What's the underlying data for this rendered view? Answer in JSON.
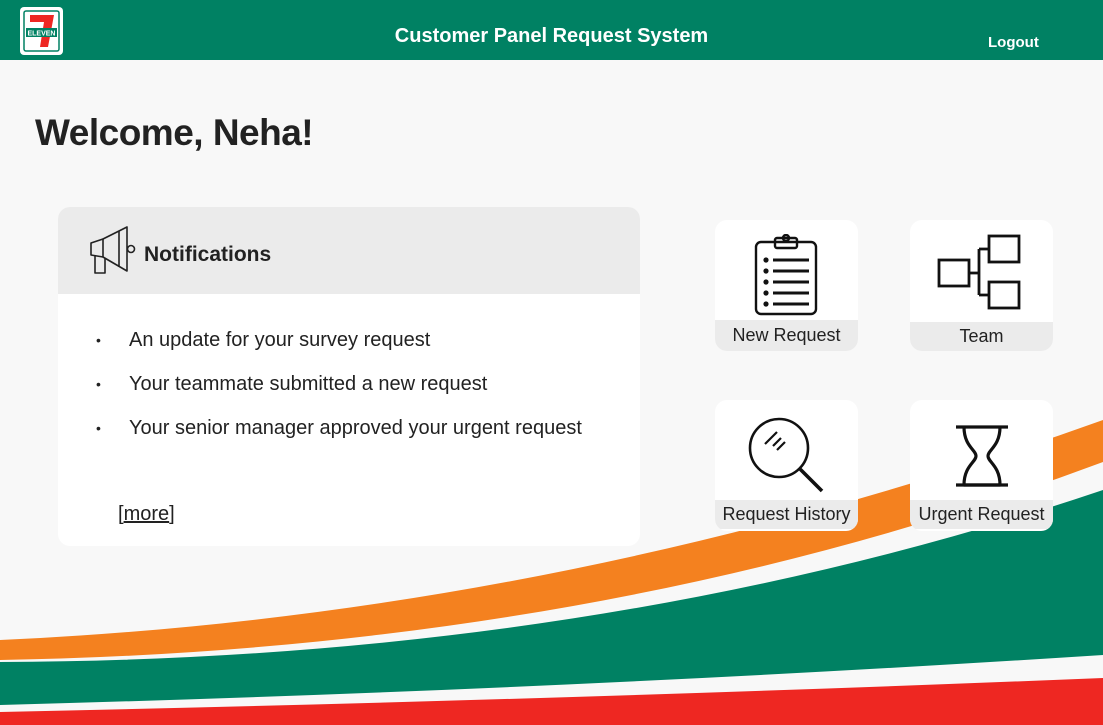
{
  "app": {
    "title": "Customer Panel Request System",
    "logout_label": "Logout",
    "logo_text": "ELEVEN",
    "logo_numeral": "7"
  },
  "welcome": {
    "heading": "Welcome, Neha!"
  },
  "notifications": {
    "title": "Notifications",
    "items": [
      "An update for your survey request",
      "Your teammate submitted a new request",
      "Your senior manager approved your urgent request"
    ],
    "bullet": "•",
    "more_label": "more",
    "more_prefix": "[",
    "more_suffix": "]"
  },
  "tiles": {
    "new_request": {
      "label": "New Request",
      "icon": "clipboard-list-icon"
    },
    "team": {
      "label": "Team",
      "icon": "org-chart-icon"
    },
    "request_history": {
      "label": "Request History",
      "icon": "magnifier-icon"
    },
    "urgent_request": {
      "label": "Urgent Request",
      "icon": "hourglass-icon"
    }
  },
  "colors": {
    "brand_green": "#008163",
    "brand_orange": "#f4811f",
    "brand_red": "#ee2722",
    "panel_gray": "#ebebeb"
  }
}
